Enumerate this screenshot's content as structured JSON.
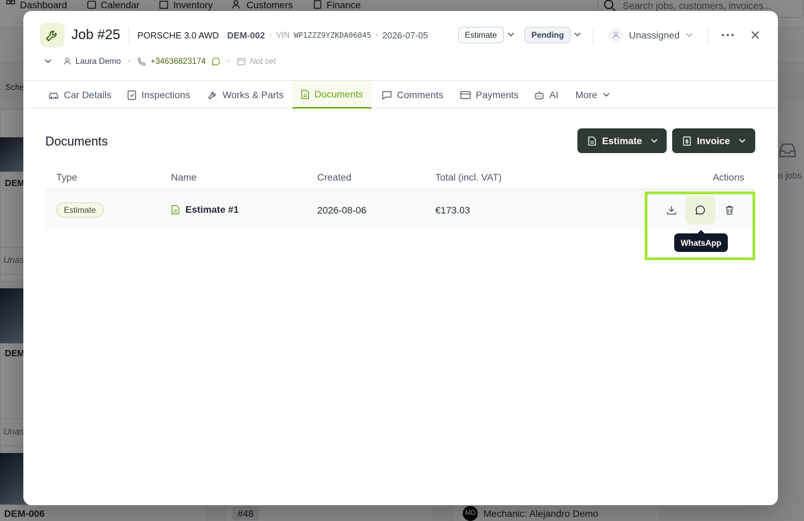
{
  "background": {
    "nav": [
      {
        "label": "Dashboard",
        "icon": "dashboard-icon"
      },
      {
        "label": "Calendar",
        "icon": "calendar-icon"
      },
      {
        "label": "Inventory",
        "icon": "inventory-icon"
      },
      {
        "label": "Customers",
        "icon": "customers-icon"
      },
      {
        "label": "Finance",
        "icon": "finance-icon"
      }
    ],
    "search_placeholder": "Search jobs, customers, invoices...",
    "sched_label": "Sche",
    "card_labels": [
      "DEM",
      "DEM",
      "DEM-006",
      "Unas",
      "Unas"
    ],
    "bottom_job": "#48",
    "bottom_mechanic": "Mechanic: Alejandro Demo",
    "bottom_mechanic_initials": "MD",
    "right_empty_text": "o jobs"
  },
  "job": {
    "title": "Job #25",
    "car_model": "PORSCHE 3.0 AWD",
    "plate": "DEM-002",
    "vin_label": "VIN",
    "vin": "WP1ZZZ9YZKDA06045",
    "date": "2026-07-05",
    "type": "Estimate",
    "status": "Pending",
    "assignee": "Unassigned",
    "customer": "Laura Demo",
    "phone": "+34636823174",
    "due": "Not set"
  },
  "tabs": [
    {
      "label": "Car Details",
      "icon": "car-icon"
    },
    {
      "label": "Inspections",
      "icon": "clipboard-icon"
    },
    {
      "label": "Works & Parts",
      "icon": "wrench-icon"
    },
    {
      "label": "Documents",
      "icon": "document-icon",
      "active": true
    },
    {
      "label": "Comments",
      "icon": "comment-icon"
    },
    {
      "label": "Payments",
      "icon": "credit-card-icon"
    },
    {
      "label": "AI",
      "icon": "robot-icon"
    },
    {
      "label": "More",
      "icon": "chevron-down-icon"
    }
  ],
  "documents": {
    "title": "Documents",
    "estimate_btn": "Estimate",
    "invoice_btn": "Invoice",
    "columns": {
      "type": "Type",
      "name": "Name",
      "created": "Created",
      "total": "Total (incl. VAT)",
      "actions": "Actions"
    },
    "rows": [
      {
        "type": "Estimate",
        "name": "Estimate #1",
        "created": "2026-08-06",
        "total": "€173.03"
      }
    ],
    "tooltip": "WhatsApp"
  },
  "colors": {
    "accent": "#65a30d",
    "dark_button": "#2f3a33",
    "highlight": "#a3e635"
  }
}
